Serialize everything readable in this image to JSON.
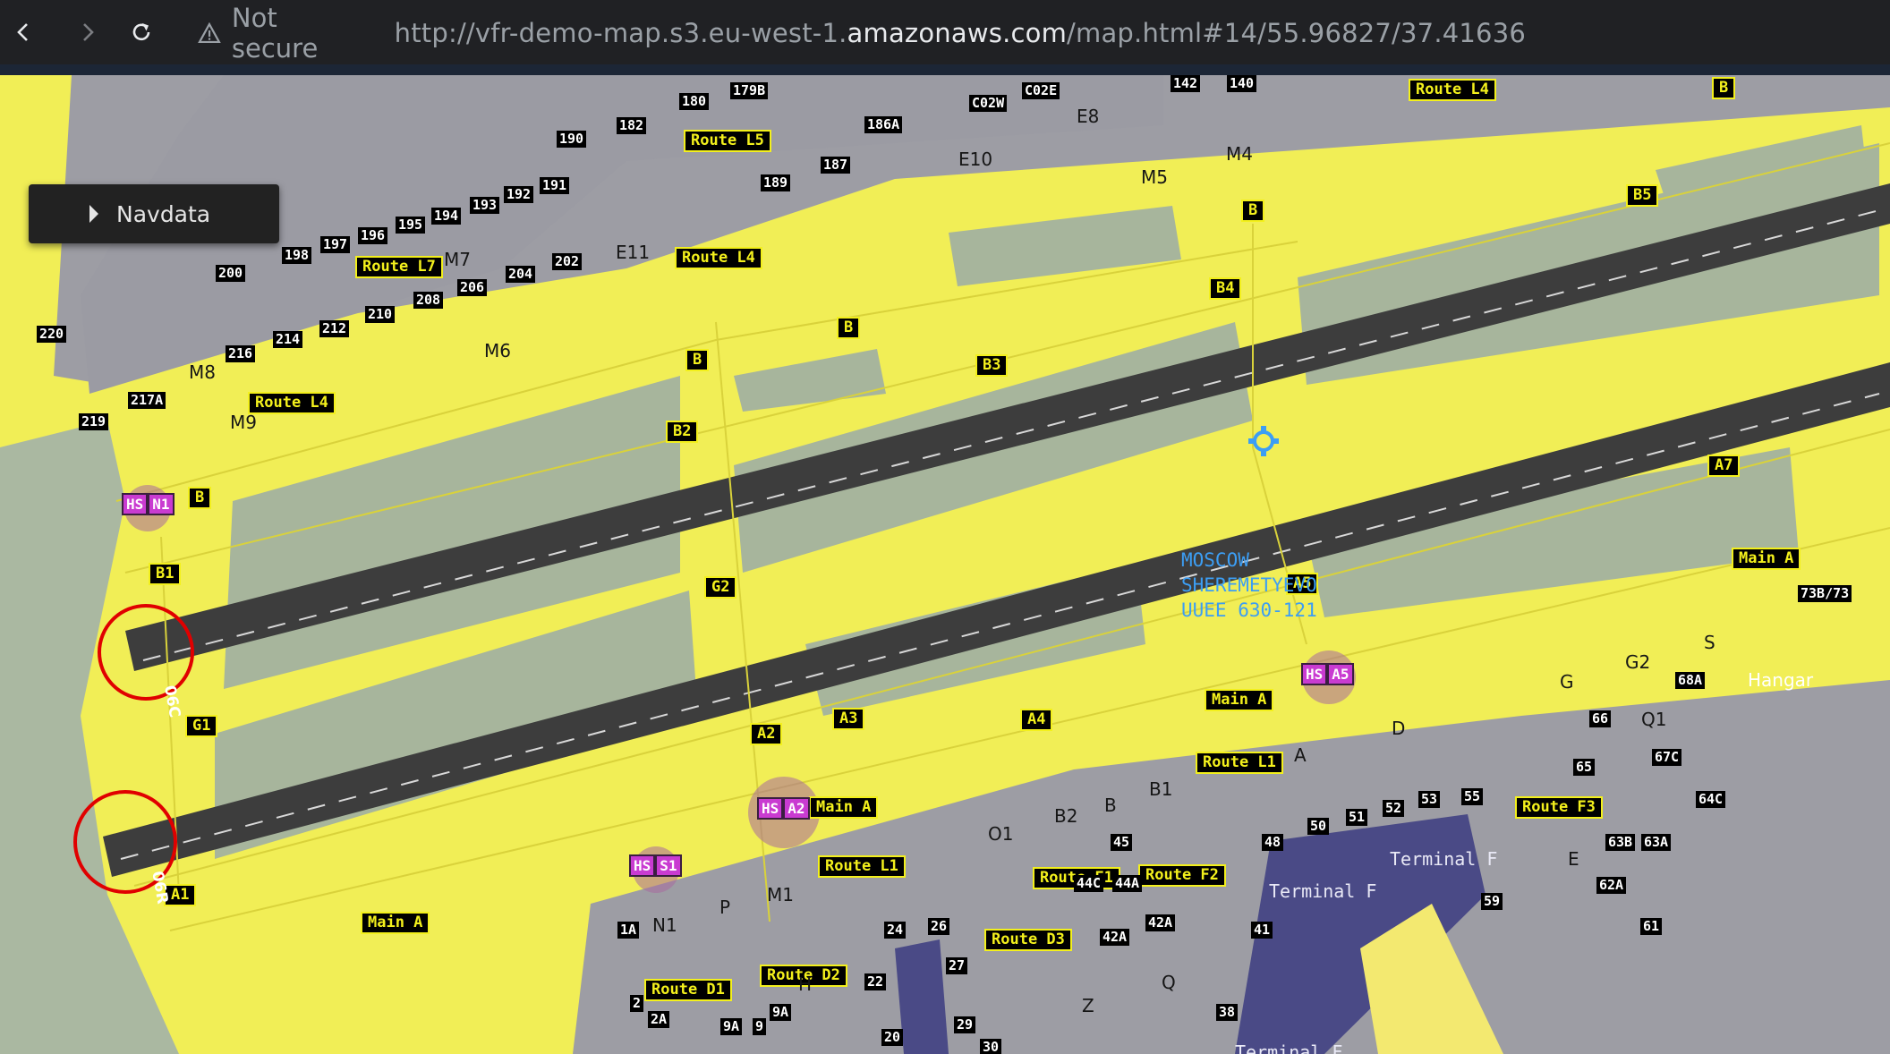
{
  "browser": {
    "security_label": "Not secure",
    "url_prefix": "http://vfr-demo-map.s3.eu-west-1.",
    "url_host": "amazonaws.com",
    "url_path": "/map.html#14/55.96827/37.41636"
  },
  "panel": {
    "navdata_label": "Navdata"
  },
  "airport": {
    "name": "MOSCOW",
    "name2": "SHEREMETYEVO",
    "code_line": "UUEE  630-121"
  },
  "runways": [
    "06C",
    "06R"
  ],
  "signs": {
    "route_l4_top": "Route L4",
    "route_l5": "Route L5",
    "route_l4_mid": "Route L4",
    "route_l7": "Route L7",
    "route_l4_left": "Route L4",
    "b_top": "B",
    "b5": "B5",
    "b_e8": "B",
    "b4": "B4",
    "b_mid": "B",
    "b3": "B3",
    "b_left": "B",
    "b2": "B2",
    "b_n1": "B",
    "b1": "B1",
    "a7": "A7",
    "main_a_right": "Main A",
    "a5": "A5",
    "g2": "G2",
    "g1": "G1",
    "main_a_mid": "Main A",
    "a4": "A4",
    "a3": "A3",
    "a2": "A2",
    "route_l1_right": "Route L1",
    "main_a_a2": "Main A",
    "route_l1_left": "Route L1",
    "route_f2": "Route F2",
    "route_f1": "Route F1",
    "route_d3": "Route D3",
    "route_d2": "Route D2",
    "route_d1": "Route D1",
    "route_f3": "Route F3",
    "a1": "A1",
    "main_a_bottom": "Main A"
  },
  "hot_spots": [
    {
      "hs": "HS",
      "id": "N1"
    },
    {
      "hs": "HS",
      "id": "A5"
    },
    {
      "hs": "HS",
      "id": "A2"
    },
    {
      "hs": "HS",
      "id": "S1"
    }
  ],
  "stands": [
    "179B",
    "180",
    "182",
    "190",
    "186A",
    "187",
    "189",
    "C02W",
    "C02E",
    "142",
    "140",
    "191",
    "192",
    "193",
    "194",
    "195",
    "196",
    "197",
    "198",
    "200",
    "202",
    "204",
    "206",
    "208",
    "210",
    "212",
    "214",
    "216",
    "217A",
    "219",
    "220",
    "73B/73",
    "68A",
    "66",
    "65",
    "67C",
    "64C",
    "63B",
    "63A",
    "62A",
    "61",
    "53",
    "52",
    "51",
    "50",
    "55",
    "48",
    "45",
    "44C",
    "44A",
    "42A",
    "42A ",
    "41",
    "38",
    "59",
    "1A",
    "2",
    "2A",
    "9A",
    "9",
    "9A ",
    "22",
    "24",
    "26",
    "27",
    "29",
    "30",
    "20"
  ],
  "taxiways": [
    "E8",
    "E10",
    "M4",
    "M5",
    "E11",
    "M7",
    "M6",
    "M8",
    "M9",
    "S",
    "G2",
    "G",
    "Q1",
    "D",
    "A",
    "B",
    "B1",
    "B2",
    "O1",
    "M1",
    "N1",
    "P",
    "Z",
    "Q",
    "E",
    "H"
  ],
  "buildings": {
    "hangar": "Hangar",
    "terminal_f_1": "Terminal F",
    "terminal_f_2": "Terminal F",
    "terminal_f_3": "Terminal F"
  }
}
